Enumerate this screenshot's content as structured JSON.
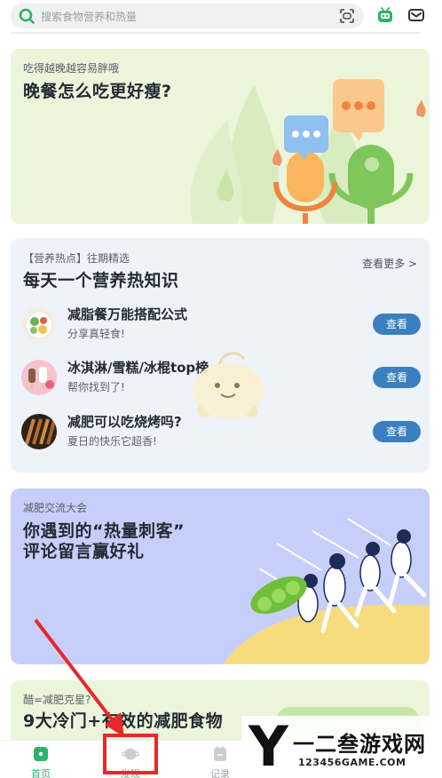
{
  "search": {
    "placeholder": "搜索食物营养和热量"
  },
  "card1": {
    "kicker": "吃得越晚越容易胖哦",
    "title": "晚餐怎么吃更好瘦?"
  },
  "card2": {
    "kicker": "【营养热点】往期精选",
    "title": "每天一个营养热知识",
    "more": "查看更多 >",
    "items": [
      {
        "title": "减脂餐万能搭配公式",
        "subtitle": "分享真轻食!",
        "button": "查看"
      },
      {
        "title": "冰淇淋/雪糕/冰棍top榜",
        "subtitle": "帮你找到了!",
        "button": "查看"
      },
      {
        "title": "减肥可以吃烧烤吗?",
        "subtitle": "夏日的快乐它超香!",
        "button": "查看"
      }
    ]
  },
  "card3": {
    "kicker": "减肥交流大会",
    "title_line1": "你遇到的“热量刺客”",
    "title_line2": "评论留言赢好礼"
  },
  "card4": {
    "kicker": "醋=减肥克星?",
    "title": "9大冷门+有效的减肥食物"
  },
  "nav": {
    "items": [
      {
        "label": "首页"
      },
      {
        "label": "发现"
      },
      {
        "label": "记录"
      }
    ]
  },
  "watermark": {
    "brand_letter": "Y",
    "brand_text": "一二叁游戏网",
    "url": "123456GAME.COM"
  },
  "colors": {
    "accent_green": "#2db26b",
    "button_blue": "#3a7fbf",
    "highlight_red": "#e8282b"
  }
}
